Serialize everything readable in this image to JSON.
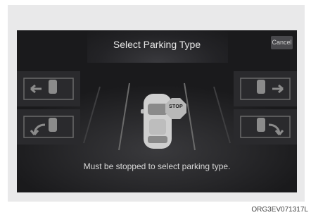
{
  "header": {
    "title": "Select Parking Type",
    "cancel_label": "Cancel"
  },
  "center": {
    "stop_label": "STOP",
    "message": "Must be stopped to select parking type."
  },
  "figure": {
    "code": "ORG3EV071317L"
  },
  "icons": {
    "left_top": "parallel-left-icon",
    "left_bottom": "reverse-left-icon",
    "right_top": "parallel-right-icon",
    "right_bottom": "reverse-right-icon"
  }
}
